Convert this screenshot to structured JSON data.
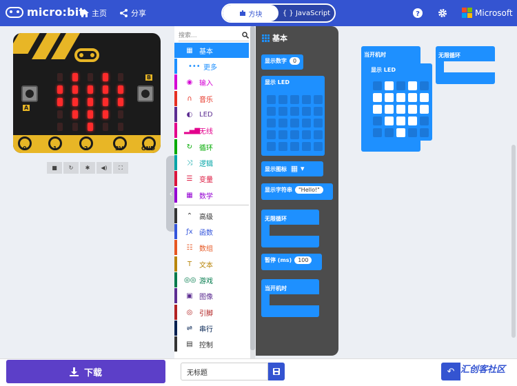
{
  "header": {
    "logo_text": "micro:bit",
    "home_label": "主页",
    "share_label": "分享",
    "mode_blocks": "方块",
    "mode_js": "{ } JavaScript",
    "help_icon": "question-circle-icon",
    "settings_icon": "gear-icon",
    "ms_label": "Microsoft",
    "colors": {
      "bar": "#3454d1"
    }
  },
  "simulator": {
    "pins": [
      "0",
      "1",
      "2",
      "3V",
      "GND"
    ],
    "button_a": "A",
    "button_b": "B",
    "led_matrix": [
      [
        0,
        1,
        0,
        1,
        0
      ],
      [
        1,
        1,
        1,
        1,
        1
      ],
      [
        1,
        1,
        1,
        1,
        1
      ],
      [
        0,
        1,
        1,
        1,
        0
      ],
      [
        0,
        0,
        1,
        0,
        0
      ]
    ],
    "tools": [
      "stop-icon",
      "restart-icon",
      "debug-icon",
      "sound-icon",
      "fullscreen-icon"
    ]
  },
  "toolbox": {
    "search_placeholder": "搜索...",
    "categories": [
      {
        "label": "基本",
        "color": "#1e90ff",
        "icon": "grid-icon"
      },
      {
        "label": "更多",
        "color": "#1e90ff",
        "icon": "dots-icon"
      },
      {
        "label": "输入",
        "color": "#d400d4",
        "icon": "target-icon"
      },
      {
        "label": "音乐",
        "color": "#e63022",
        "icon": "headphones-icon"
      },
      {
        "label": "LED",
        "color": "#5c2d91",
        "icon": "toggle-icon"
      },
      {
        "label": "无线",
        "color": "#e3008c",
        "icon": "signal-icon"
      },
      {
        "label": "循环",
        "color": "#00aa00",
        "icon": "refresh-icon"
      },
      {
        "label": "逻辑",
        "color": "#00a4a6",
        "icon": "shuffle-icon"
      },
      {
        "label": "变量",
        "color": "#dc143c",
        "icon": "list-icon"
      },
      {
        "label": "数学",
        "color": "#9400d3",
        "icon": "calculator-icon"
      },
      {
        "label": "高级",
        "color": "#333333",
        "icon": "chevron-up-icon"
      },
      {
        "label": "函数",
        "color": "#3455db",
        "icon": "function-icon"
      },
      {
        "label": "数组",
        "color": "#e65722",
        "icon": "array-icon"
      },
      {
        "label": "文本",
        "color": "#b8860b",
        "icon": "text-icon"
      },
      {
        "label": "游戏",
        "color": "#007a4b",
        "icon": "gamepad-icon"
      },
      {
        "label": "图像",
        "color": "#5c2d91",
        "icon": "image-icon"
      },
      {
        "label": "引脚",
        "color": "#b22222",
        "icon": "pin-icon"
      },
      {
        "label": "串行",
        "color": "#002050",
        "icon": "usb-icon"
      },
      {
        "label": "控制",
        "color": "#333333",
        "icon": "control-icon"
      }
    ]
  },
  "flyout": {
    "title": "基本",
    "show_number": "显示数字",
    "show_number_value": "0",
    "show_led": "显示 LED",
    "show_icon": "显示图标",
    "show_string": "显示字符串",
    "show_string_value": "\"Hello!\"",
    "forever": "无限循环",
    "pause": "暂停 (ms)",
    "pause_value": "100",
    "on_start": "当开机时"
  },
  "workspace": {
    "on_start": "当开机时",
    "show_led": "显示 LED",
    "forever": "无限循环",
    "led_matrix": [
      [
        0,
        1,
        0,
        1,
        0
      ],
      [
        1,
        1,
        1,
        1,
        1
      ],
      [
        1,
        1,
        1,
        1,
        1
      ],
      [
        0,
        1,
        1,
        1,
        0
      ],
      [
        0,
        0,
        1,
        0,
        0
      ]
    ]
  },
  "bottom": {
    "download_label": "下载",
    "project_name": "无标题",
    "watermark": "汇创客社区"
  }
}
